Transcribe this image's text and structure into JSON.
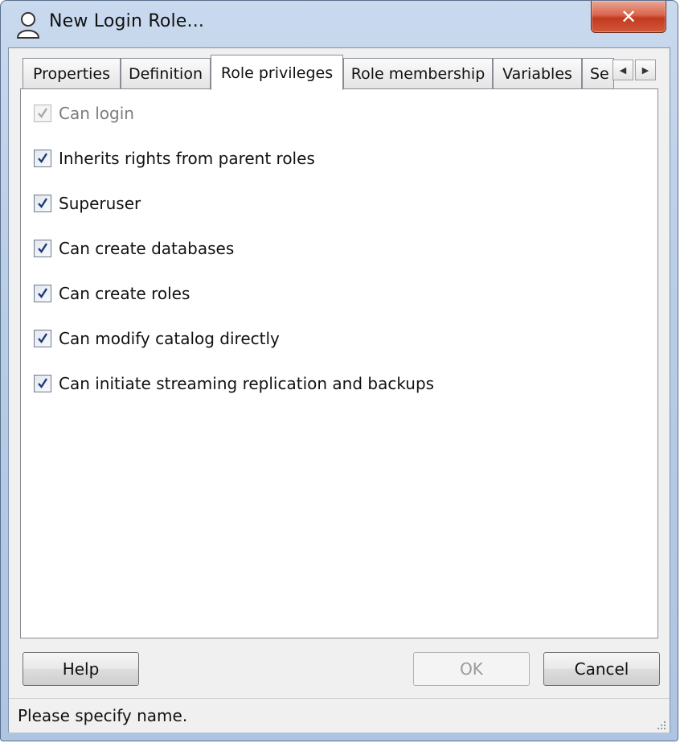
{
  "window": {
    "title": "New Login Role...",
    "close_label": "✕"
  },
  "tabs": [
    {
      "label": "Properties",
      "active": false
    },
    {
      "label": "Definition",
      "active": false
    },
    {
      "label": "Role privileges",
      "active": true
    },
    {
      "label": "Role membership",
      "active": false
    },
    {
      "label": "Variables",
      "active": false
    },
    {
      "label": "Se",
      "active": false
    }
  ],
  "tab_scroll": {
    "left_label": "◀",
    "right_label": "▶"
  },
  "privileges": [
    {
      "label": "Can login",
      "checked": true,
      "enabled": false
    },
    {
      "label": "Inherits rights from parent roles",
      "checked": true,
      "enabled": true
    },
    {
      "label": "Superuser",
      "checked": true,
      "enabled": true
    },
    {
      "label": "Can create databases",
      "checked": true,
      "enabled": true
    },
    {
      "label": "Can create roles",
      "checked": true,
      "enabled": true
    },
    {
      "label": "Can modify catalog directly",
      "checked": true,
      "enabled": true
    },
    {
      "label": "Can initiate streaming replication and backups",
      "checked": true,
      "enabled": true
    }
  ],
  "buttons": {
    "help": "Help",
    "ok": "OK",
    "cancel": "Cancel"
  },
  "status": {
    "text": "Please specify name."
  },
  "colors": {
    "title_gradient": "#c9d9ee",
    "close_button": "#c23a20",
    "checkbox_check": "#1f3a7a"
  }
}
